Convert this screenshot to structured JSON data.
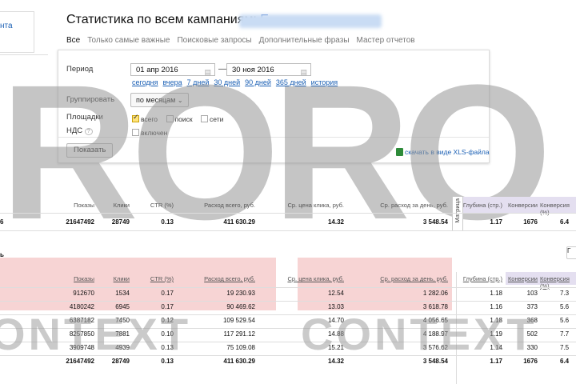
{
  "sidebar": {
    "link_fragment": "нта"
  },
  "header": {
    "title": "Статистика по всем кампаниям:",
    "title_suffix": "E"
  },
  "tabs": [
    "Все",
    "Только самые важные",
    "Поисковые запросы",
    "Дополнительные фразы",
    "Мастер отчетов"
  ],
  "filters": {
    "period_label": "Период",
    "date_from": "01 апр 2016",
    "date_to": "30 ноя 2016",
    "dash": "—",
    "quick_links": [
      "сегодня",
      "вчера",
      "7 дней",
      "30 дней",
      "90 дней",
      "365 дней",
      "история"
    ],
    "group_label": "Группировать",
    "group_value": "по месяцам",
    "platforms_label": "Площадки",
    "platform_options": [
      {
        "label": "всего",
        "checked": true
      },
      {
        "label": "поиск",
        "checked": false
      },
      {
        "label": "сети",
        "checked": false
      }
    ],
    "vat_label": "НДС",
    "vat_help": "?",
    "vat_option": "включен",
    "show_button": "Показать",
    "xls_link": "скачать в виде XLS-файла"
  },
  "matrix_label": "Матрица",
  "summary": {
    "row_label": "6",
    "headers": [
      "Показы",
      "Клики",
      "CTR (%)",
      "Расход всего, руб.",
      "Ср. цена клика, руб.",
      "Ср. расход за день, руб.",
      "Глубина (стр.)",
      "Конверсии",
      "Конверсия (%)"
    ],
    "values": [
      "21647492",
      "28749",
      "0.13",
      "411 630.29",
      "14.32",
      "3 548.54",
      "1.17",
      "1676",
      "6.4"
    ]
  },
  "detail": {
    "section_mark": "ь",
    "top_button": "Г",
    "headers": [
      "Показы",
      "Клики",
      "CTR (%)",
      "Расход всего, руб.",
      "Ср. цена клика, руб.",
      "Ср. расход за день, руб.",
      "Глубина (стр.)",
      "Конверсии",
      "Конверсия (%)"
    ],
    "rows": [
      [
        "912670",
        "1534",
        "0.17",
        "19 230.93",
        "12.54",
        "1 282.06",
        "1.18",
        "103",
        "7.3"
      ],
      [
        "4180242",
        "6945",
        "0.17",
        "90 469.62",
        "13.03",
        "3 618.78",
        "1.16",
        "373",
        "5.6"
      ],
      [
        "6387182",
        "7450",
        "0.12",
        "109 529.54",
        "14.70",
        "4 056.65",
        "1.18",
        "368",
        "5.6"
      ],
      [
        "8257850",
        "7881",
        "0.10",
        "117 291.12",
        "14.88",
        "4 188.97",
        "1.19",
        "502",
        "7.7"
      ],
      [
        "3909748",
        "4939",
        "0.13",
        "75 109.08",
        "15.21",
        "3 576.62",
        "1.14",
        "330",
        "7.5"
      ]
    ],
    "total": [
      "21647492",
      "28749",
      "0.13",
      "411 630.29",
      "14.32",
      "3 548.54",
      "1.17",
      "1676",
      "6.4"
    ]
  },
  "watermark": {
    "big": "RORO",
    "small_left": "ONTEXT",
    "small_right": "CONTEXT"
  }
}
